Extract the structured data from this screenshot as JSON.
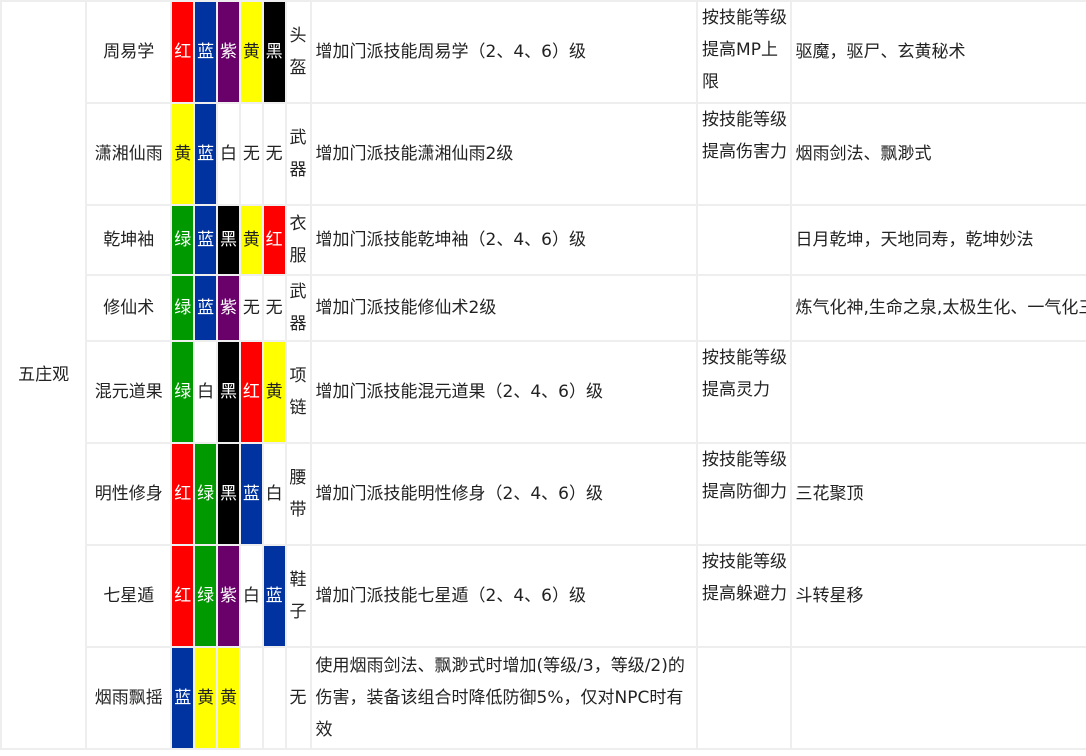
{
  "section": "五庄观",
  "rows": [
    {
      "name": "周易学",
      "colors": [
        {
          "t": "红",
          "c": "red"
        },
        {
          "t": "蓝",
          "c": "blue"
        },
        {
          "t": "紫",
          "c": "purple"
        },
        {
          "t": "黄",
          "c": "yellow"
        },
        {
          "t": "黑",
          "c": "black"
        }
      ],
      "slot": "头盔",
      "effect": "增加门派技能周易学（2、4、6）级",
      "bonus": "按技能等级提高MP上限",
      "skills": "驱魔，驱尸、玄黄秘术"
    },
    {
      "name": "潇湘仙雨",
      "colors": [
        {
          "t": "黄",
          "c": "yellow"
        },
        {
          "t": "蓝",
          "c": "blue"
        },
        {
          "t": "白",
          "c": "white"
        },
        {
          "t": "无",
          "c": "none"
        },
        {
          "t": "无",
          "c": "none"
        }
      ],
      "slot": "武器",
      "effect": "增加门派技能潇湘仙雨2级",
      "bonus": "按技能等级提高伤害力",
      "skills": "烟雨剑法、飘渺式"
    },
    {
      "name": "乾坤袖",
      "colors": [
        {
          "t": "绿",
          "c": "green"
        },
        {
          "t": "蓝",
          "c": "blue"
        },
        {
          "t": "黑",
          "c": "black"
        },
        {
          "t": "黄",
          "c": "yellow"
        },
        {
          "t": "红",
          "c": "red"
        }
      ],
      "slot": "衣服",
      "effect": "增加门派技能乾坤袖（2、4、6）级",
      "bonus": "",
      "skills": "日月乾坤，天地同寿，乾坤妙法"
    },
    {
      "name": "修仙术",
      "colors": [
        {
          "t": "绿",
          "c": "green"
        },
        {
          "t": "蓝",
          "c": "blue"
        },
        {
          "t": "紫",
          "c": "purple"
        },
        {
          "t": "无",
          "c": "none"
        },
        {
          "t": "无",
          "c": "none"
        }
      ],
      "slot": "武器",
      "effect": "增加门派技能修仙术2级",
      "bonus": "",
      "skills": "炼气化神,生命之泉,太极生化、一气化三清"
    },
    {
      "name": "混元道果",
      "colors": [
        {
          "t": "绿",
          "c": "green"
        },
        {
          "t": "白",
          "c": "white"
        },
        {
          "t": "黑",
          "c": "black"
        },
        {
          "t": "红",
          "c": "red"
        },
        {
          "t": "黄",
          "c": "yellow"
        }
      ],
      "slot": "项链",
      "effect": "增加门派技能混元道果（2、4、6）级",
      "bonus": "按技能等级提高灵力",
      "skills": ""
    },
    {
      "name": "明性修身",
      "colors": [
        {
          "t": "红",
          "c": "red"
        },
        {
          "t": "绿",
          "c": "green"
        },
        {
          "t": "黑",
          "c": "black"
        },
        {
          "t": "蓝",
          "c": "blue"
        },
        {
          "t": "白",
          "c": "white"
        }
      ],
      "slot": "腰带",
      "effect": "增加门派技能明性修身（2、4、6）级",
      "bonus": "按技能等级提高防御力",
      "skills": "三花聚顶"
    },
    {
      "name": "七星遁",
      "colors": [
        {
          "t": "红",
          "c": "red"
        },
        {
          "t": "绿",
          "c": "green"
        },
        {
          "t": "紫",
          "c": "purple"
        },
        {
          "t": "白",
          "c": "white"
        },
        {
          "t": "蓝",
          "c": "blue"
        }
      ],
      "slot": "鞋子",
      "effect": "增加门派技能七星遁（2、4、6）级",
      "bonus": "按技能等级提高躲避力",
      "skills": "斗转星移"
    },
    {
      "name": "烟雨飘摇",
      "colors": [
        {
          "t": "蓝",
          "c": "blue"
        },
        {
          "t": "黄",
          "c": "yellow"
        },
        {
          "t": "黄",
          "c": "yellow"
        },
        {
          "t": "",
          "c": "none"
        },
        {
          "t": "",
          "c": "none"
        }
      ],
      "slot": "无",
      "effect": "使用烟雨剑法、飘渺式时增加(等级/3，等级/2)的伤害，装备该组合时降低防御5%，仅对NPC时有效",
      "bonus": "",
      "skills": ""
    }
  ]
}
